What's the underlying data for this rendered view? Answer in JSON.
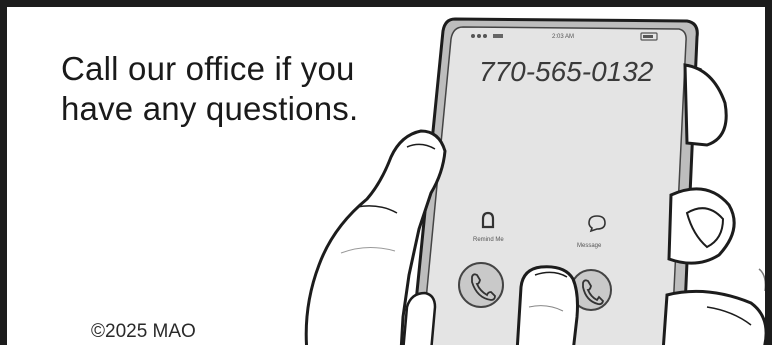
{
  "message": {
    "line1": "Call our office if you",
    "line2": "have any questions."
  },
  "phone": {
    "number": "770-565-0132",
    "status_time": "2:03 AM",
    "action_left_label": "Remind Me",
    "action_right_label": "Message"
  },
  "footer": {
    "copyright": "©2025 MAO"
  },
  "colors": {
    "ink": "#1c1c1c",
    "screen": "#e4e4e4",
    "phone_body": "#b9b9b9",
    "button_fill": "#c9c9c9"
  }
}
